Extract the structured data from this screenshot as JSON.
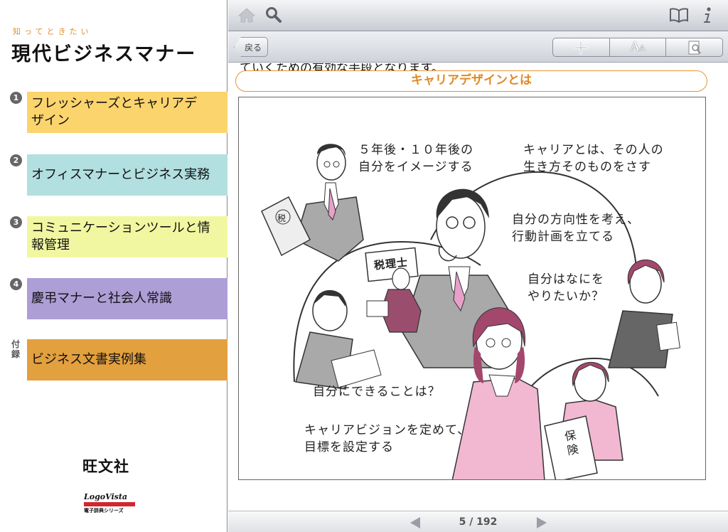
{
  "sidebar": {
    "brand_sub": "知ってときたい",
    "brand_title": "現代ビジネスマナー",
    "chapters": [
      {
        "num": "1",
        "label": "フレッシャーズとキャリアデザイン"
      },
      {
        "num": "2",
        "label": "オフィスマナーとビジネス実務"
      },
      {
        "num": "3",
        "label": "コミュニケーションツールと情報管理"
      },
      {
        "num": "4",
        "label": "慶弔マナーと社会人常識"
      },
      {
        "num": "付録",
        "label": "ビジネス文書実例集"
      }
    ],
    "publisher": "旺文社",
    "logo_top": "LogoVista",
    "logo_bottom": "電子辞典シリーズ"
  },
  "toolbar": {
    "icons": [
      "home-icon",
      "search-icon",
      "book-icon",
      "info-icon"
    ],
    "back_label": "戻る",
    "segment_icons": [
      "plus-icon",
      "font-size-icon",
      "page-zoom-icon"
    ],
    "font_glyph": "A",
    "font_glyph_small": "A"
  },
  "content": {
    "cut_text": "ていくための有効な手段となります。",
    "section_title": "キャリアデザインとは",
    "figure_texts": {
      "t1": "５年後・１０年後の\n自分をイメージする",
      "t2": "キャリアとは、その人の\n生き方そのものをさす",
      "t3": "自分の方向性を考え、\n行動計画を立てる",
      "t4": "自分はなにを\nやりたいか？",
      "t5": "自分にできることは？",
      "t6": "キャリアビジョンを定めて、\n目標を設定する",
      "sign": "税理士",
      "doc1": "税",
      "doc2": "保\n険"
    }
  },
  "pager": {
    "page": "5 / 192"
  },
  "colors": {
    "accent_orange": "#e08a25",
    "chapter_1": "#fbd46d",
    "chapter_2": "#b2dfe0",
    "chapter_3": "#f1f7a1",
    "chapter_4": "#ad9ed6",
    "chapter_5": "#e3a03e"
  }
}
